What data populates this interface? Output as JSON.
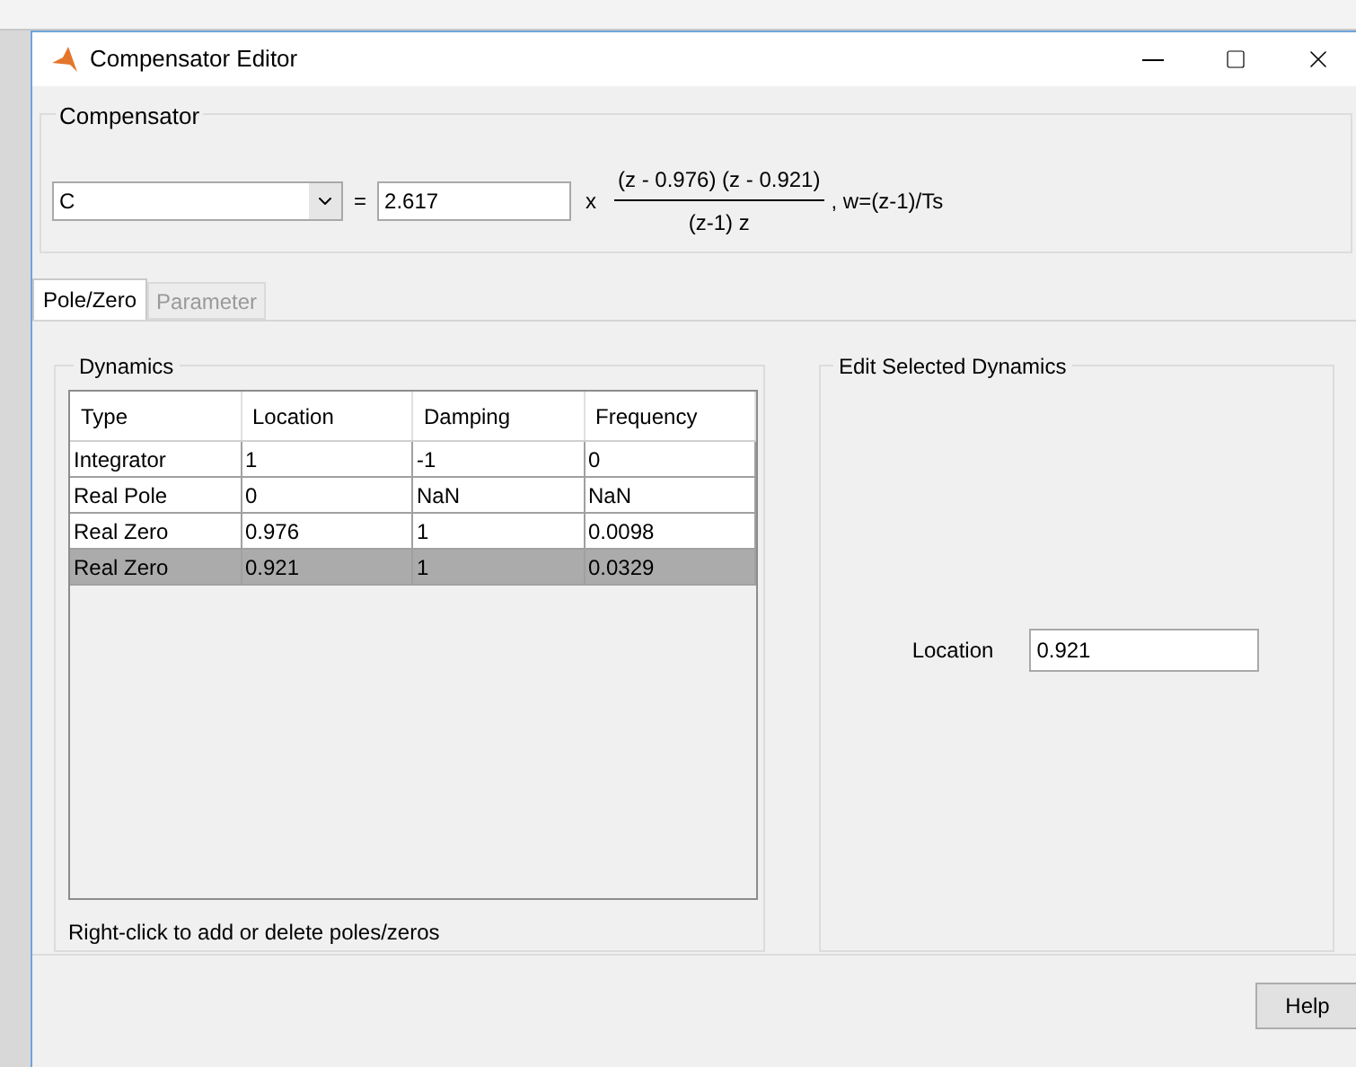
{
  "window": {
    "title": "Compensator Editor"
  },
  "compensator": {
    "title": "Compensator",
    "name": "C",
    "equals": "=",
    "gain": "2.617",
    "times": "x",
    "numerator": "(z - 0.976) (z - 0.921)",
    "denominator": "(z-1) z",
    "suffix": ", w=(z-1)/Ts"
  },
  "tabs": [
    {
      "label": "Pole/Zero",
      "selected": true,
      "disabled": false
    },
    {
      "label": "Parameter",
      "selected": false,
      "disabled": true
    }
  ],
  "dynamics": {
    "title": "Dynamics",
    "columns": [
      "Type",
      "Location",
      "Damping",
      "Frequency"
    ],
    "rows": [
      {
        "cells": [
          "Integrator",
          "1",
          "-1",
          "0"
        ],
        "selected": false
      },
      {
        "cells": [
          "Real Pole",
          "0",
          "NaN",
          "NaN"
        ],
        "selected": false
      },
      {
        "cells": [
          "Real Zero",
          "0.976",
          "1",
          "0.0098"
        ],
        "selected": false
      },
      {
        "cells": [
          "Real Zero",
          "0.921",
          "1",
          "0.0329"
        ],
        "selected": true
      }
    ],
    "hint": "Right-click to add or delete poles/zeros"
  },
  "edit": {
    "title": "Edit Selected Dynamics",
    "label": "Location",
    "value": "0.921"
  },
  "buttons": [
    "Help"
  ]
}
